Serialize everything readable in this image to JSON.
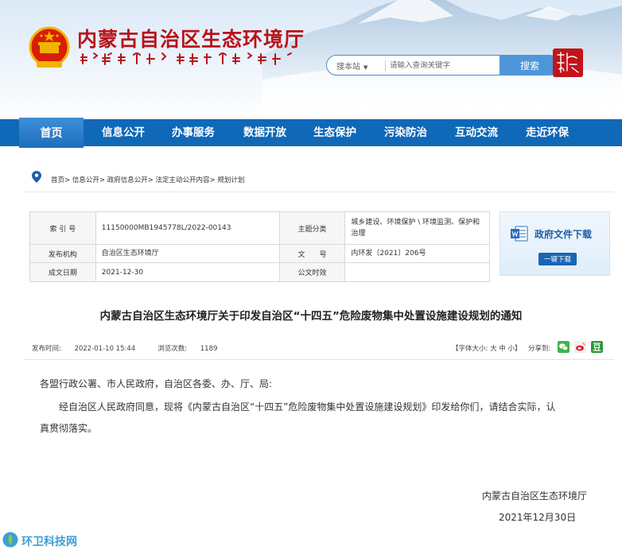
{
  "header": {
    "site_title": "内蒙古自治区生态环境厅",
    "search": {
      "scope_label": "搜本站",
      "placeholder": "请输入查询关键字",
      "button_label": "搜索"
    }
  },
  "nav": {
    "items": [
      "首页",
      "信息公开",
      "办事服务",
      "数据开放",
      "生态保护",
      "污染防治",
      "互动交流",
      "走近环保"
    ]
  },
  "breadcrumb": {
    "items": [
      "首页",
      "信息公开",
      "政府信息公开",
      "法定主动公开内容",
      "规划计划"
    ],
    "separator": ">"
  },
  "info_table": {
    "index_label": "索 引 号",
    "index_value": "11150000MB1945778L/2022-00143",
    "category_label": "主题分类",
    "category_value": "城乡建设、环境保护 \\ 环境监测、保护和治理",
    "issuer_label": "发布机构",
    "issuer_value": "自治区生态环境厅",
    "docno_label": "文　　号",
    "docno_value": "内环发〔2021〕206号",
    "date_label": "成文日期",
    "date_value": "2021-12-30",
    "public_label": "公文时效",
    "public_value": ""
  },
  "download": {
    "title": "政府文件下载",
    "button_label": "一键下载"
  },
  "article": {
    "title": "内蒙古自治区生态环境厅关于印发自治区“十四五”危险废物集中处置设施建设规划的通知",
    "publish_time_label": "发布时间:",
    "publish_time": "2022-01-10 15:44",
    "views_label": "浏览次数:",
    "views": "1189",
    "font_size_ctrl": "【字体大小: 大 中 小】",
    "share_label": "分享到:",
    "salutation": "各盟行政公署、市人民政府，自治区各委、办、厅、局:",
    "body_line1": "经自治区人民政府同意，现将《内蒙古自治区“十四五”危险废物集中处置设施建设规划》印发给你们，请结合实际，认",
    "body_line2": "真贯彻落实。",
    "signature_org": "内蒙古自治区生态环境厅",
    "signature_date": "2021年12月30日"
  },
  "watermark": {
    "text": "环卫科技网"
  },
  "colors": {
    "nav_blue": "#0f68b8",
    "title_red": "#b8131b",
    "search_blue": "#4d97d9"
  }
}
